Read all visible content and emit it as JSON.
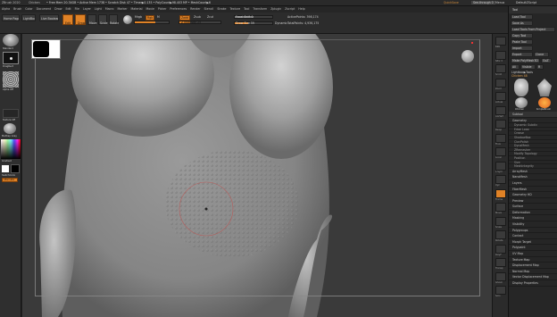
{
  "titlebar": {
    "app_title": "ZBrush 2020",
    "doc_label": "Chicken",
    "mem_text": "• Free Mem 20.34GB • Active Mem 1738 • Scratch Disk 47 • Timer▶0.135 • PolyCount▶98.403 MP • MeshCount▶6",
    "quicksave": "QuickSave",
    "see_through": "See-through 0",
    "menus_label": "Menus",
    "default_script": "DefaultZScript"
  },
  "menubar": {
    "items": [
      "Alpha",
      "Brush",
      "Color",
      "Document",
      "Draw",
      "Edit",
      "File",
      "Layer",
      "Light",
      "Macro",
      "Marker",
      "Material",
      "Movie",
      "Picker",
      "Preferences",
      "Render",
      "Stencil",
      "Stroke",
      "Texture",
      "Tool",
      "Transform",
      "Zplugin",
      "Zscript",
      "Help"
    ]
  },
  "topshelf": {
    "home_page": "Home Page",
    "lightbox": "LightBox",
    "live_boolean": "Live Boolean",
    "edit": "Edit",
    "draw": "Draw",
    "move": "Move",
    "scale": "Scale",
    "rotate": "Rotate",
    "mrgb": "Mrgb",
    "rgb": "Rgb",
    "m": "M",
    "zadd": "Zadd",
    "zsub": "Zsub",
    "zcut": "Zcut",
    "rgb_intensity": "Rgb Intensity",
    "z_intensity": "Z Intensity 25",
    "focal_shift": "Focal Shift 0",
    "draw_size": "Draw Size 59",
    "dynamic": "Dynamic",
    "active_points": "ActivePoints: 398,174",
    "total_points": "TotalPoints: 4,936,175"
  },
  "lefttray": {
    "brush_label": "Standard",
    "stroke_label": "DragRect",
    "alpha_label": "Alpha Off",
    "texture_label": "Texture Off",
    "material_label": "MatCap Gray",
    "gradient_label": "Gradient",
    "switch_label": "SwitchColor",
    "alternate_label": "Alternate"
  },
  "righttray": {
    "icons": [
      "BPR",
      "SPix 3",
      "Scroll",
      "Zoom",
      "Actual",
      "AAHalf",
      "Persp",
      "Floor",
      "Local",
      "L.Sym",
      "Xyz",
      "Frame",
      "Move",
      "Scale",
      "Rotate",
      "PolyF",
      "Transp",
      "Ghost",
      "Solo"
    ]
  },
  "toolpanel": {
    "title": "Tool",
    "load_tool": "Load Tool",
    "save_as": "Save As",
    "load_tools_project": "Load Tools From Project",
    "copy_tool": "Copy Tool",
    "paste_tool": "Paste Tool",
    "import": "Import",
    "export": "Export",
    "clone": "Clone",
    "make_polymesh": "Make PolyMesh3D",
    "goz": "GoZ",
    "all": "All",
    "visible": "Visible",
    "r": "R",
    "lightbox_tools": "Lightbox▶Tools",
    "tool_name": "Chicken 48",
    "tool_thumbs": [
      "Chicken",
      "PolyMesh3D",
      "SimpleBrush"
    ],
    "subtool": "Subtool",
    "geometry": "Geometry",
    "array_mesh": "ArrayMesh",
    "nanomesh": "NanoMesh",
    "layers": "Layers",
    "fibermesh": "FiberMesh",
    "geometry_hd": "Geometry HD",
    "preview": "Preview",
    "surface": "Surface",
    "deformation": "Deformation",
    "masking": "Masking",
    "visibility": "Visibility",
    "polygroups": "Polygroups",
    "contact": "Contact",
    "morph_target": "Morph Target",
    "polypaint": "Polypaint",
    "uv_map": "UV Map",
    "texture_map": "Texture Map",
    "displacement_map": "Displacement Map",
    "normal_map": "Normal Map",
    "vector_disp_map": "Vector Displacement Map",
    "display_properties": "Display Properties",
    "unified_skin": "Unified Skin",
    "initialize": "Initialize",
    "import_section": "Import",
    "export_section": "Export",
    "sub_items": [
      "Dynamic Subdiv",
      "Edge Loop",
      "Crease",
      "ShadowBox",
      "ClayPolish",
      "DynaMesh",
      "ZRemesher",
      "Modify Topology",
      "Position",
      "Size",
      "MeshIntegrity"
    ],
    "list_items": [
      "List All",
      "Auto Collapse",
      "Rename",
      "AutoReorder",
      "Append",
      "Insert",
      "Duplicate",
      "Delete",
      "Split",
      "Merge",
      "Boolean"
    ]
  },
  "colors": {
    "accent": "#e08226",
    "bg": "#1e1e1e",
    "panel": "#262626"
  }
}
